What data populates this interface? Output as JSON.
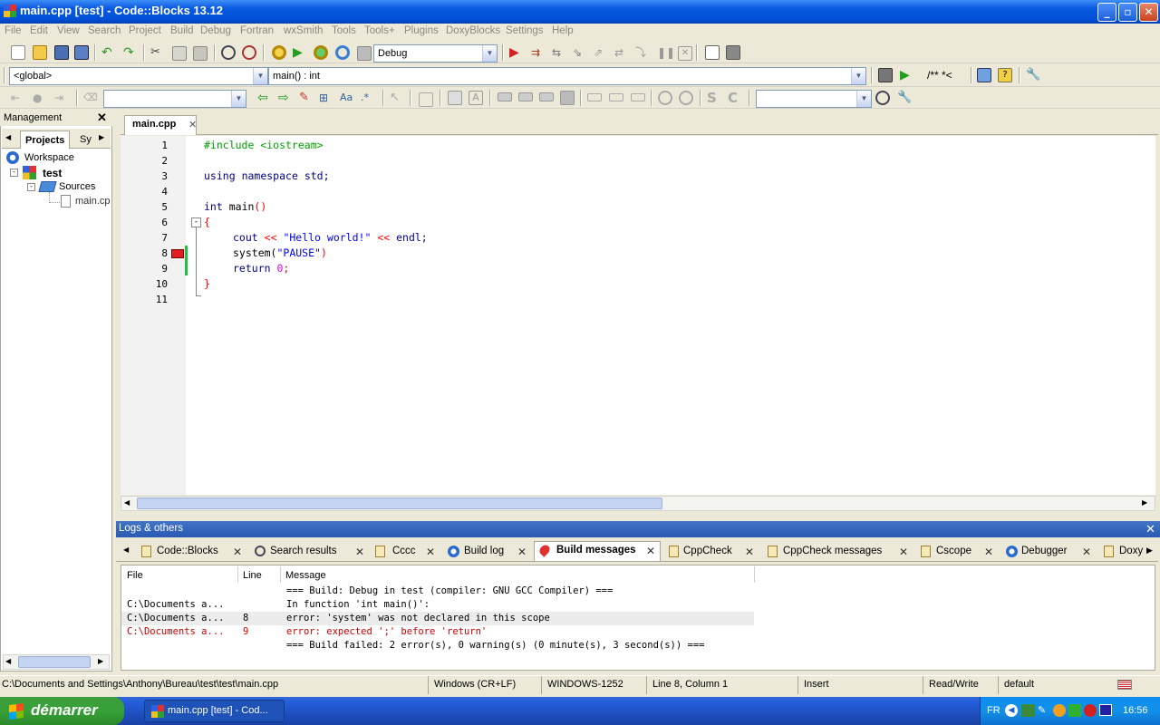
{
  "window": {
    "title": "main.cpp [test] - Code::Blocks 13.12"
  },
  "menu": [
    "File",
    "Edit",
    "View",
    "Search",
    "Project",
    "Build",
    "Debug",
    "Fortran",
    "wxSmith",
    "Tools",
    "Tools+",
    "Plugins",
    "DoxyBlocks",
    "Settings",
    "Help"
  ],
  "toolbar": {
    "build_target": "Debug",
    "comment_label": "/** *<"
  },
  "codecompletion": {
    "scope": "<global>",
    "symbol": "main() : int"
  },
  "management": {
    "title": "Management",
    "tabs": [
      "Projects",
      "Sy"
    ],
    "tree": {
      "workspace": "Workspace",
      "project": "test",
      "folder": "Sources",
      "file": "main.cpp"
    }
  },
  "editor": {
    "tab": "main.cpp",
    "line_numbers": [
      "1",
      "2",
      "3",
      "4",
      "5",
      "6",
      "7",
      "8",
      "9",
      "10",
      "11"
    ],
    "lines": {
      "l1": "#include <iostream>",
      "l3a": "using",
      "l3b": "namespace",
      "l3c": "std;",
      "l5a": "int",
      "l5b": "main",
      "l5c": "()",
      "l6": "{",
      "l7a": "cout",
      "l7b": "<<",
      "l7c": "\"Hello world!\"",
      "l7d": "<<",
      "l7e": "endl;",
      "l8a": "system(",
      "l8b": "\"PAUSE\"",
      "l8c": ")",
      "l9a": "return",
      "l9b": "0",
      "l9c": ";",
      "l10": "}"
    },
    "error_marker_line": 8
  },
  "logs": {
    "title": "Logs & others",
    "tabs": [
      "Code::Blocks",
      "Search results",
      "Cccc",
      "Build log",
      "Build messages",
      "CppCheck",
      "CppCheck messages",
      "Cscope",
      "Debugger",
      "Doxy"
    ],
    "active_tab": "Build messages",
    "columns": [
      "File",
      "Line",
      "Message"
    ],
    "rows": [
      {
        "file": "",
        "line": "",
        "message": "=== Build: Debug in test (compiler: GNU GCC Compiler) ==="
      },
      {
        "file": "C:\\Documents a...",
        "line": "",
        "message": "In function 'int main()':"
      },
      {
        "file": "C:\\Documents a...",
        "line": "8",
        "message": "error: 'system' was not declared in this scope"
      },
      {
        "file": "C:\\Documents a...",
        "line": "9",
        "message": "error: expected ';' before 'return'"
      },
      {
        "file": "",
        "line": "",
        "message": "=== Build failed: 2 error(s), 0 warning(s) (0 minute(s), 3 second(s)) ==="
      }
    ]
  },
  "status": {
    "path": "C:\\Documents and Settings\\Anthony\\Bureau\\test\\test\\main.cpp",
    "eol": "Windows (CR+LF)",
    "encoding": "WINDOWS-1252",
    "position": "Line 8, Column 1",
    "mode": "Insert",
    "access": "Read/Write",
    "theme": "default"
  },
  "taskbar": {
    "start": "démarrer",
    "task": "main.cpp [test] - Cod...",
    "lang": "FR",
    "clock": "16:56"
  },
  "colors": {
    "error_red": "#cc0000",
    "titlebar_blue": "#0a5ae0",
    "start_green": "#37a037"
  }
}
